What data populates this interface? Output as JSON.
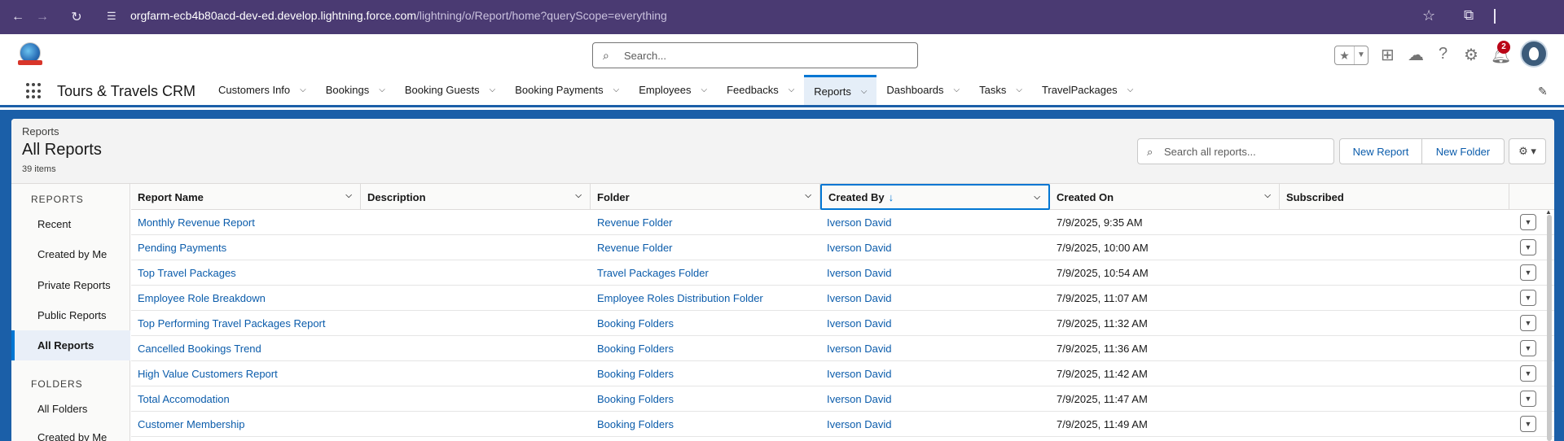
{
  "browser": {
    "url_host": "orgfarm-ecb4b80acd-dev-ed.develop.lightning.force.com",
    "url_path": "/lightning/o/Report/home?queryScope=everything"
  },
  "header": {
    "search_placeholder": "Search...",
    "notification_count": "2"
  },
  "app": {
    "name": "Tours & Travels CRM",
    "nav": [
      {
        "label": "Customers Info"
      },
      {
        "label": "Bookings"
      },
      {
        "label": "Booking Guests"
      },
      {
        "label": "Booking Payments"
      },
      {
        "label": "Employees"
      },
      {
        "label": "Feedbacks"
      },
      {
        "label": "Reports",
        "active": true
      },
      {
        "label": "Dashboards"
      },
      {
        "label": "Tasks"
      },
      {
        "label": "TravelPackages"
      }
    ]
  },
  "page": {
    "breadcrumb": "Reports",
    "title": "All Reports",
    "count": "39 items",
    "search_placeholder": "Search all reports...",
    "new_report": "New Report",
    "new_folder": "New Folder"
  },
  "sidebar": {
    "reports_heading": "REPORTS",
    "reports_items": [
      "Recent",
      "Created by Me",
      "Private Reports",
      "Public Reports",
      "All Reports"
    ],
    "active_item": "All Reports",
    "folders_heading": "FOLDERS",
    "folders_items": [
      "All Folders",
      "Created by Me"
    ]
  },
  "table": {
    "columns": [
      "Report Name",
      "Description",
      "Folder",
      "Created By",
      "Created On",
      "Subscribed"
    ],
    "sorted_column": "Created By",
    "rows": [
      {
        "name": "Monthly Revenue Report",
        "description": "",
        "folder": "Revenue Folder",
        "created_by": "Iverson David",
        "created_on": "7/9/2025, 9:35 AM",
        "subscribed": ""
      },
      {
        "name": "Pending Payments",
        "description": "",
        "folder": "Revenue Folder",
        "created_by": "Iverson David",
        "created_on": "7/9/2025, 10:00 AM",
        "subscribed": ""
      },
      {
        "name": "Top Travel Packages",
        "description": "",
        "folder": "Travel Packages Folder",
        "created_by": "Iverson David",
        "created_on": "7/9/2025, 10:54 AM",
        "subscribed": ""
      },
      {
        "name": "Employee Role Breakdown",
        "description": "",
        "folder": "Employee Roles Distribution Folder",
        "created_by": "Iverson David",
        "created_on": "7/9/2025, 11:07 AM",
        "subscribed": ""
      },
      {
        "name": "Top Performing Travel Packages Report",
        "description": "",
        "folder": "Booking Folders",
        "created_by": "Iverson David",
        "created_on": "7/9/2025, 11:32 AM",
        "subscribed": ""
      },
      {
        "name": "Cancelled Bookings Trend",
        "description": "",
        "folder": "Booking Folders",
        "created_by": "Iverson David",
        "created_on": "7/9/2025, 11:36 AM",
        "subscribed": ""
      },
      {
        "name": "High Value Customers Report",
        "description": "",
        "folder": "Booking Folders",
        "created_by": "Iverson David",
        "created_on": "7/9/2025, 11:42 AM",
        "subscribed": ""
      },
      {
        "name": "Total Accomodation",
        "description": "",
        "folder": "Booking Folders",
        "created_by": "Iverson David",
        "created_on": "7/9/2025, 11:47 AM",
        "subscribed": ""
      },
      {
        "name": "Customer Membership",
        "description": "",
        "folder": "Booking Folders",
        "created_by": "Iverson David",
        "created_on": "7/9/2025, 11:49 AM",
        "subscribed": ""
      }
    ]
  },
  "colors": {
    "brand_blue": "#1b5fa8",
    "link_blue": "#0b5cab",
    "accent": "#0176d3",
    "browser_chrome": "#4a3a72"
  }
}
